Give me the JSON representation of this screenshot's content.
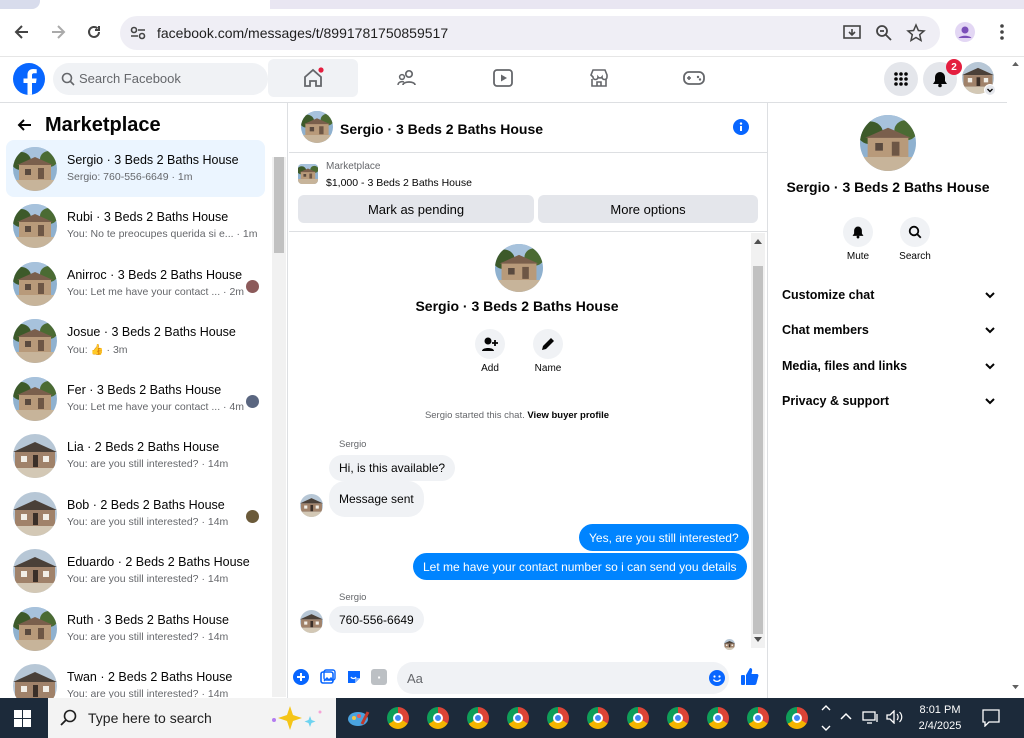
{
  "browser": {
    "url": "facebook.com/messages/t/8991781750859517"
  },
  "fb_header": {
    "search_placeholder": "Search Facebook",
    "notification_count": "2"
  },
  "sidebar": {
    "title": "Marketplace",
    "conversations": [
      {
        "title": "Sergio · 3 Beds 2 Baths House",
        "subtitle": "Sergio: 760-556-6649 · 1m",
        "selected": true
      },
      {
        "title": "Rubi · 3 Beds 2 Baths House",
        "subtitle": "You: No te preocupes querida si e... · 1m"
      },
      {
        "title": "Anirroc · 3 Beds 2 Baths House",
        "subtitle": "You: Let me have your contact ... · 2m"
      },
      {
        "title": "Josue · 3 Beds 2 Baths House",
        "subtitle": "You: 👍 · 3m"
      },
      {
        "title": "Fer · 3 Beds 2 Baths House",
        "subtitle": "You: Let me have your contact ... · 4m"
      },
      {
        "title": "Lia · 2 Beds 2 Baths House",
        "subtitle": "You: are you still interested? · 14m"
      },
      {
        "title": "Bob · 2 Beds 2 Baths House",
        "subtitle": "You: are you still interested? · 14m"
      },
      {
        "title": "Eduardo · 2 Beds 2 Baths House",
        "subtitle": "You: are you still interested? · 14m"
      },
      {
        "title": "Ruth · 3 Beds 2 Baths House",
        "subtitle": "You: are you still interested? · 14m"
      },
      {
        "title": "Twan · 2 Beds 2 Baths House",
        "subtitle": "You: are you still interested? · 14m"
      }
    ]
  },
  "chat": {
    "title": "Sergio · 3 Beds 2 Baths House",
    "listing_source": "Marketplace",
    "listing_line": "$1,000 - 3 Beds 2 Baths House",
    "mark_pending_label": "Mark as pending",
    "more_options_label": "More options",
    "intro_title": "Sergio · 3 Beds 2 Baths House",
    "add_label": "Add",
    "name_label": "Name",
    "started_text": "Sergio started this chat.",
    "view_profile_link": "View buyer profile",
    "sender_name": "Sergio",
    "messages": {
      "m1": "Hi, is this available?",
      "m2": "Message sent",
      "m3": "Yes, are you still interested?",
      "m4": "Let me have your contact number so i can send you details",
      "m5": "760-556-6649"
    },
    "sender_name_2": "Sergio",
    "compose_placeholder": "Aa"
  },
  "details": {
    "title": "Sergio · 3 Beds 2 Baths House",
    "mute_label": "Mute",
    "search_label": "Search",
    "sections": [
      "Customize chat",
      "Chat members",
      "Media, files and links",
      "Privacy & support"
    ]
  },
  "taskbar": {
    "search_placeholder": "Type here to search",
    "time": "8:01 PM",
    "date": "2/4/2025"
  },
  "colors": {
    "fb_blue": "#0866ff",
    "messenger_blue": "#0084ff",
    "selected_row": "#ebf5ff",
    "badge_red": "#e41e3f"
  }
}
